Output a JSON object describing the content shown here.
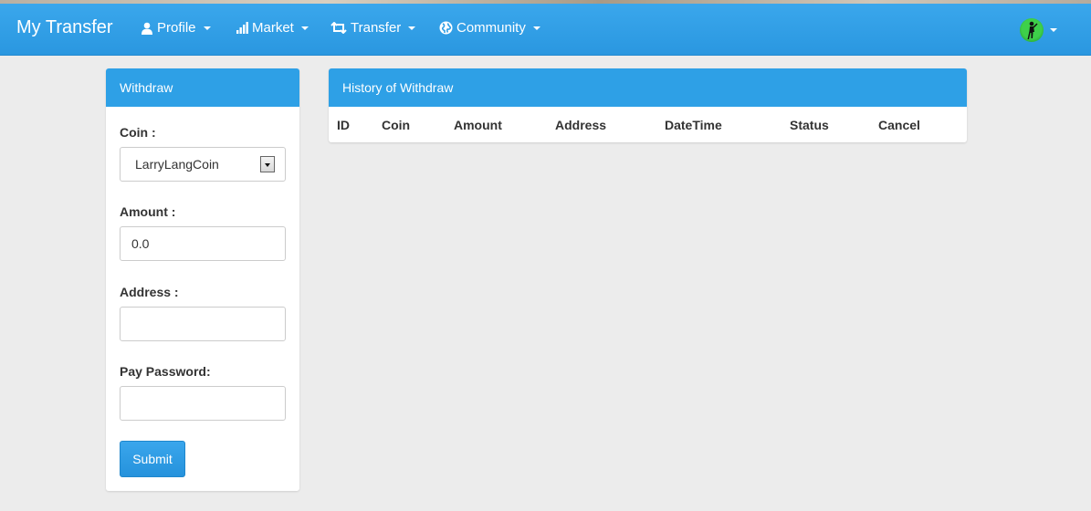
{
  "navbar": {
    "brand": "My Transfer",
    "items": [
      {
        "label": "Profile",
        "icon": "user-icon"
      },
      {
        "label": "Market",
        "icon": "bar-chart-icon"
      },
      {
        "label": "Transfer",
        "icon": "retweet-icon"
      },
      {
        "label": "Community",
        "icon": "globe-icon"
      }
    ],
    "colors": {
      "bar": "#2e9fe6",
      "text": "#ffffff"
    }
  },
  "withdraw": {
    "title": "Withdraw",
    "coin_label": "Coin :",
    "coin_value": "LarryLangCoin",
    "amount_label": "Amount :",
    "amount_value": "0.0",
    "address_label": "Address :",
    "address_value": "",
    "pay_password_label": "Pay Password:",
    "pay_password_value": "",
    "submit_label": "Submit"
  },
  "history": {
    "title": "History of Withdraw",
    "columns": [
      "ID",
      "Coin",
      "Amount",
      "Address",
      "DateTime",
      "Status",
      "Cancel"
    ],
    "rows": []
  }
}
